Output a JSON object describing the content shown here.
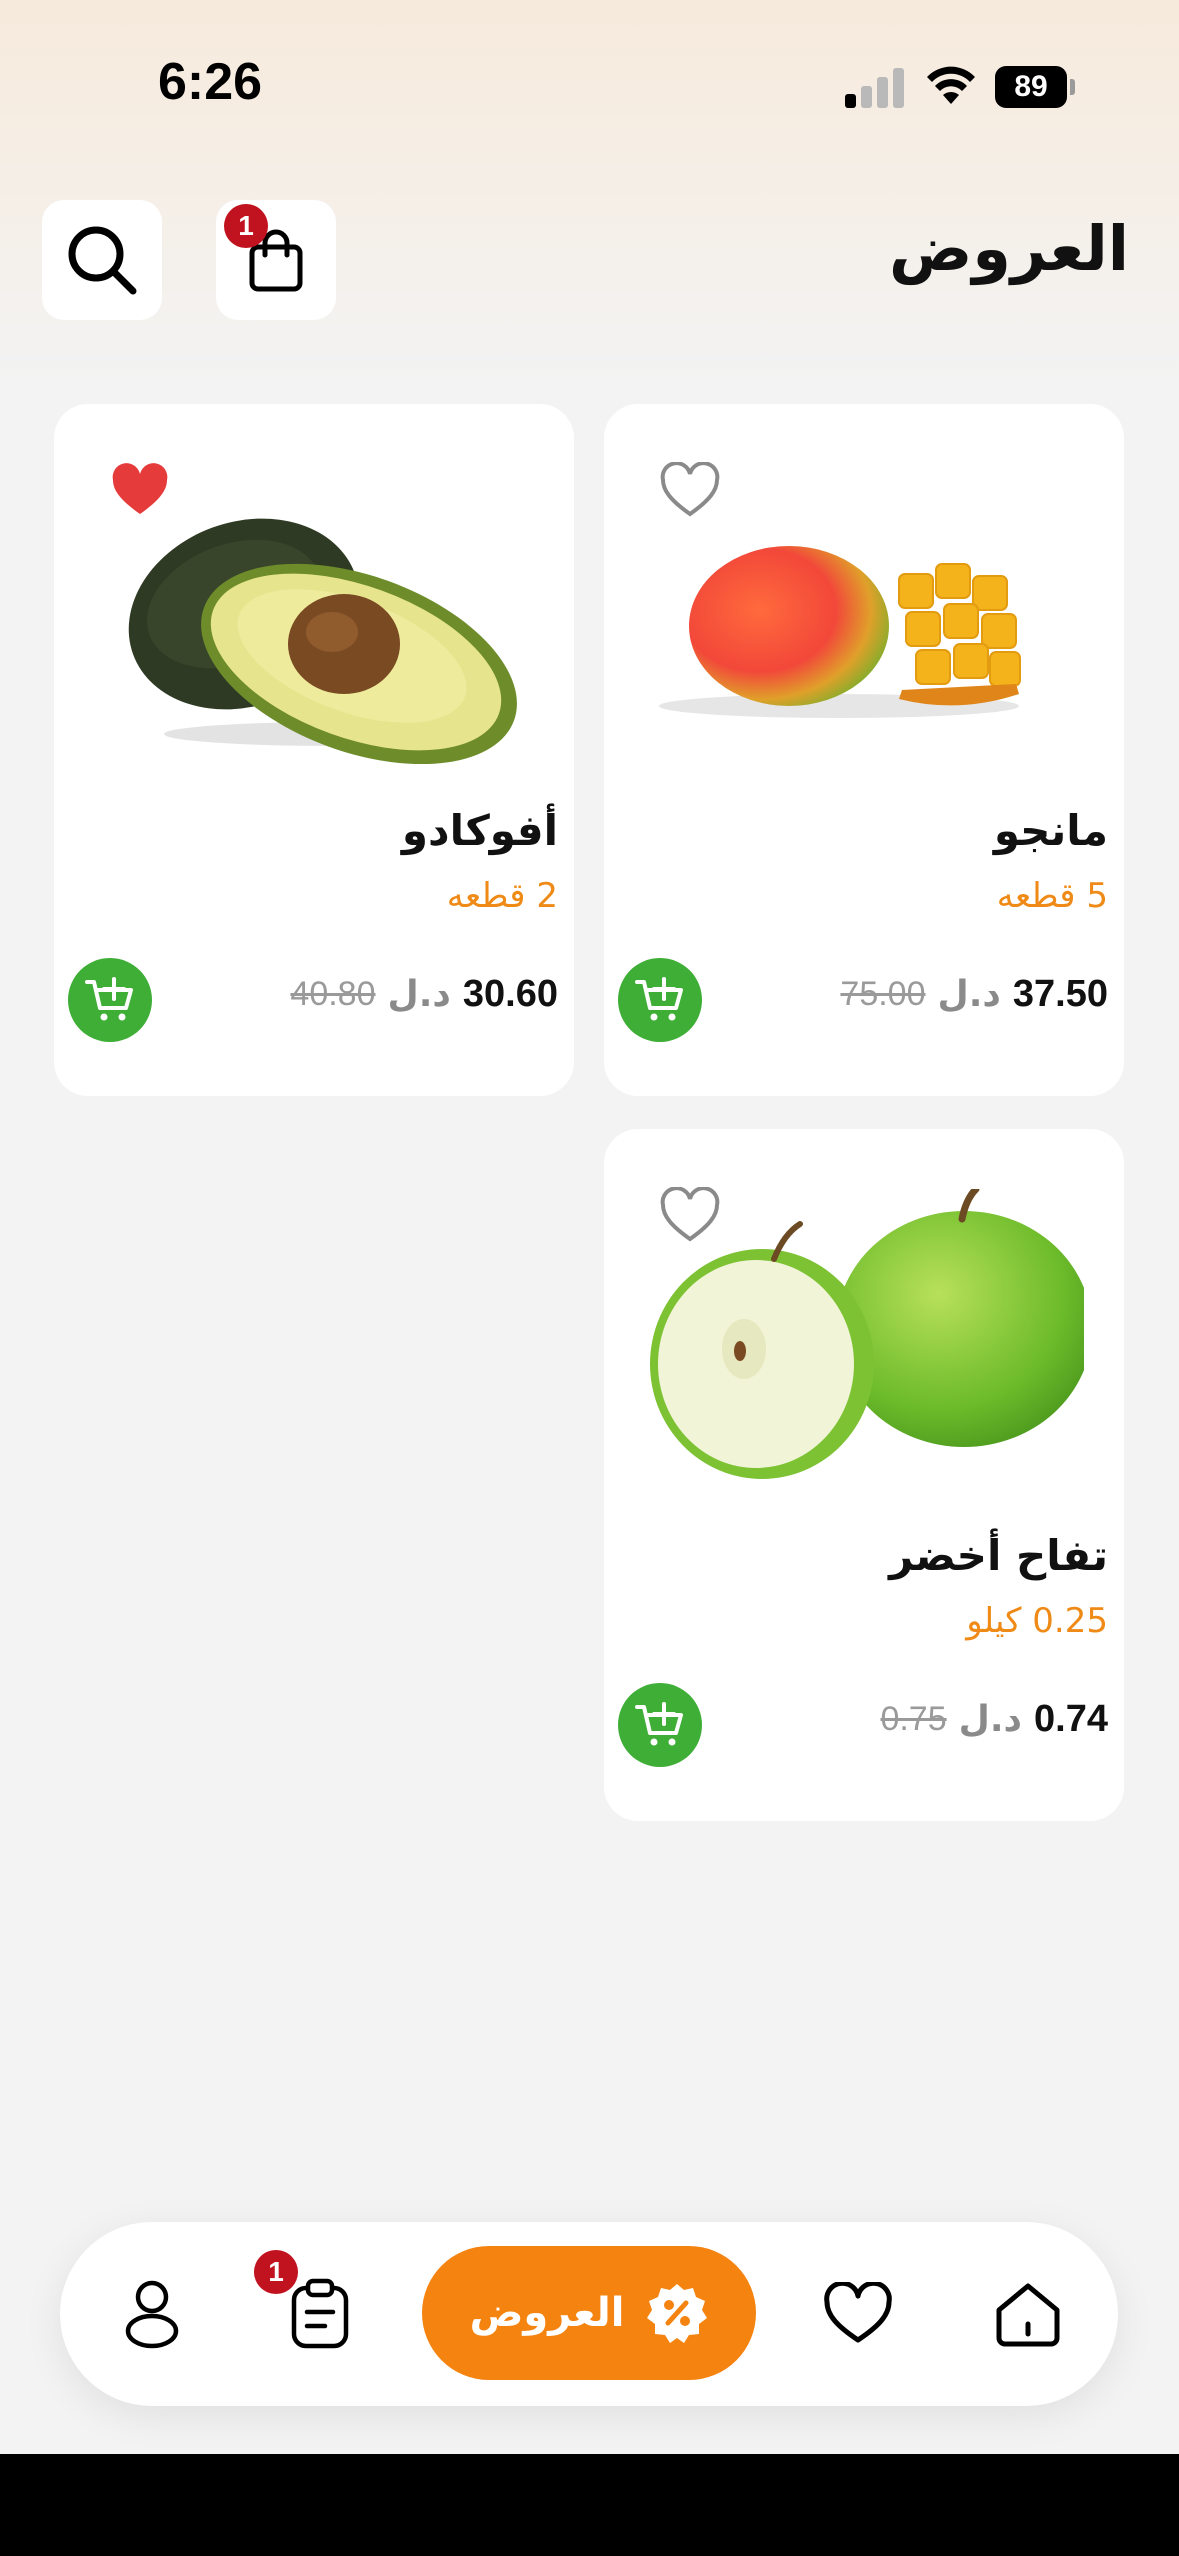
{
  "status_bar": {
    "time": "6:26",
    "battery": "89"
  },
  "header": {
    "title": "العروض",
    "cart_badge": "1"
  },
  "icons": {
    "search": "search-icon",
    "cart": "shopping-bag-icon",
    "favorite": "heart-icon",
    "add_to_cart": "cart-plus-icon"
  },
  "products": [
    {
      "name": "مانجو",
      "unit": "5 قطعه",
      "price": "37.50",
      "currency": "د.ل",
      "old_price": "75.00",
      "favorite": false
    },
    {
      "name": "أفوكادو",
      "unit": "2 قطعه",
      "price": "30.60",
      "currency": "د.ل",
      "old_price": "40.80",
      "favorite": true
    },
    {
      "name": "تفاح أخضر",
      "unit": "0.25 كيلو",
      "price": "0.74",
      "currency": "د.ل",
      "old_price": "0.75",
      "favorite": false
    }
  ],
  "bottom_nav": {
    "offers_label": "العروض",
    "orders_badge": "1",
    "items": [
      "profile-icon",
      "orders-icon",
      "offers-icon",
      "heart-icon",
      "home-icon"
    ]
  },
  "colors": {
    "accent_orange": "#f5830f",
    "unit_orange": "#ef8a17",
    "add_green": "#3eae36",
    "badge_red": "#c1121f",
    "favorite_red": "#e63b3b"
  }
}
